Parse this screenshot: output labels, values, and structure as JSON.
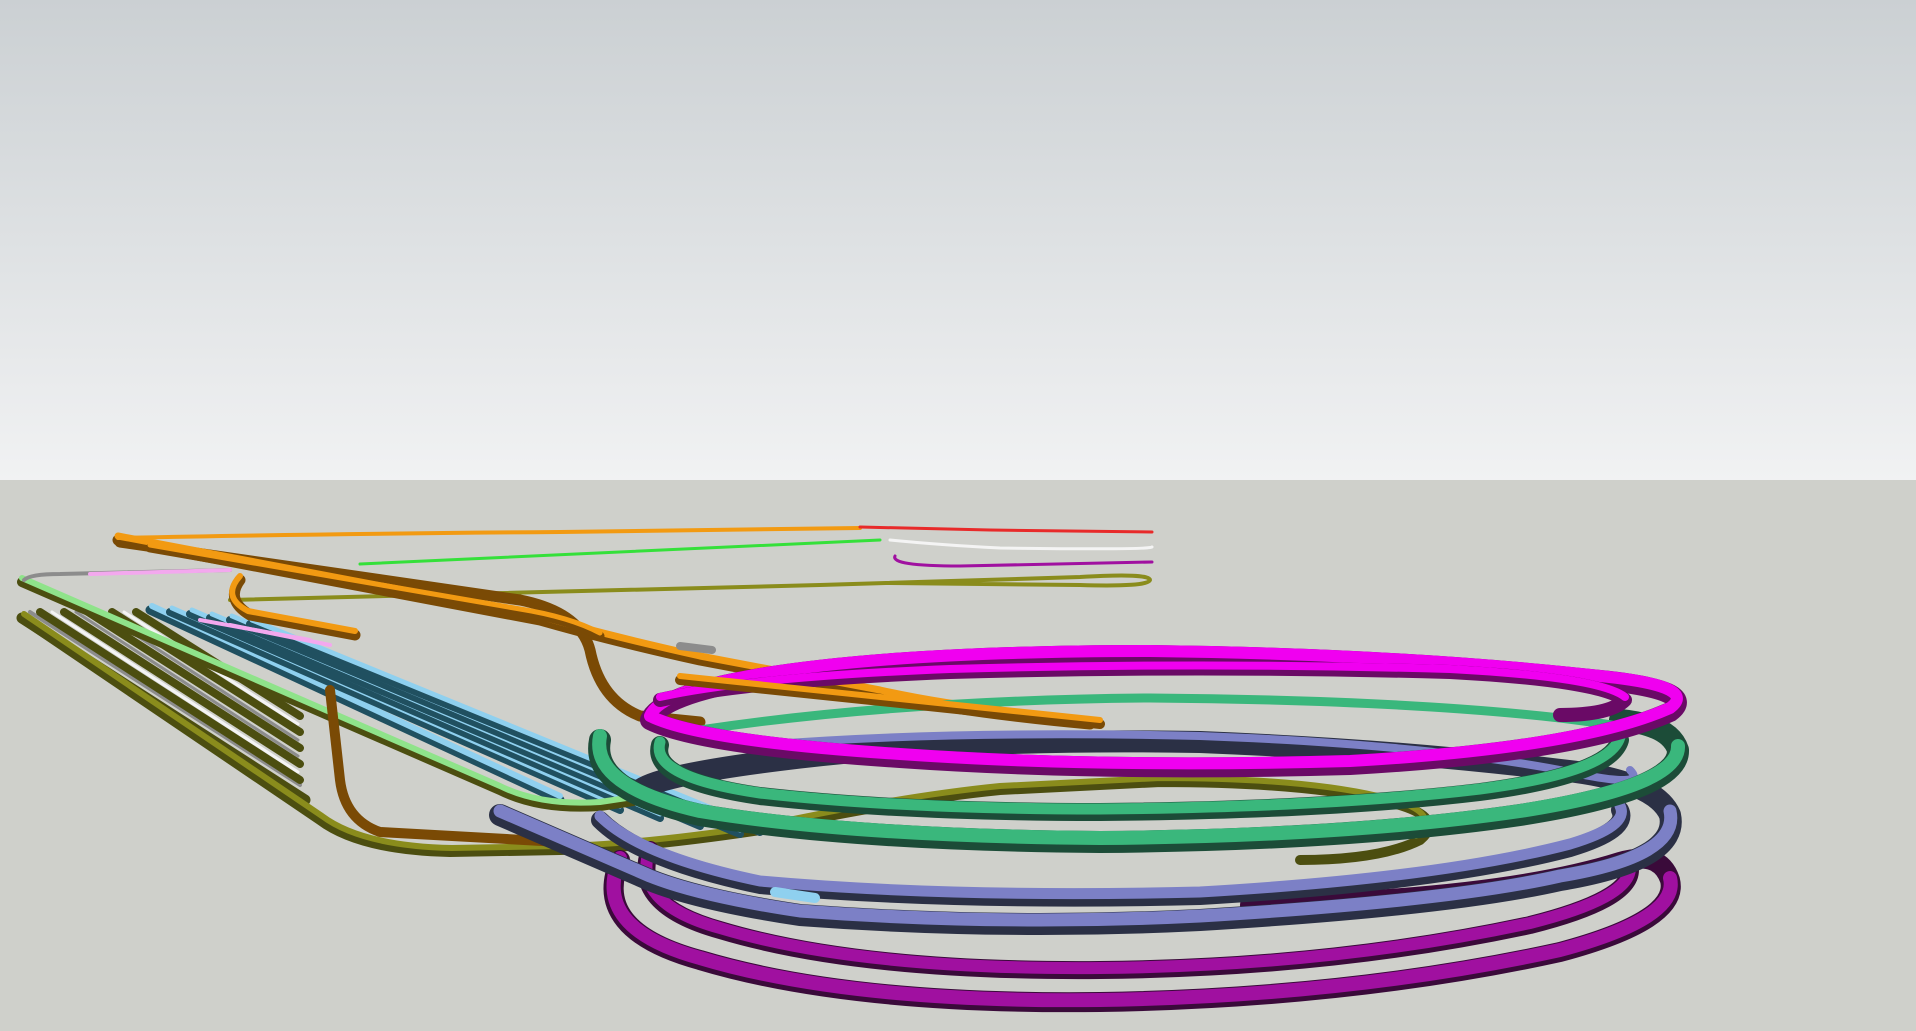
{
  "viewport": {
    "app": "3D model viewer",
    "sky_top_color": "#cbd0d3",
    "sky_bottom_color": "#f1f2f3",
    "ground_color": "#cfd0cb"
  },
  "track_colors": {
    "orange": "#f29a12",
    "orange_dark": "#7a4a05",
    "magenta": "#f000f0",
    "magenta_dark": "#6a0a66",
    "green": "#3ab77c",
    "green_dark": "#1c4c38",
    "periwinkle": "#7c80c6",
    "navy": "#2b3045",
    "purple": "#a010a0",
    "purple_dark": "#3a0a3a",
    "olive": "#8a8c1c",
    "olive_dark": "#4c4e10",
    "light_green": "#8fe38a",
    "light_blue": "#8fd0ef",
    "blue_dark": "#205060",
    "grey": "#8c8c8c",
    "white": "#f4f4f4",
    "pink": "#f3a8ee",
    "red": "#e82a2a",
    "bright_green": "#35e03a"
  }
}
